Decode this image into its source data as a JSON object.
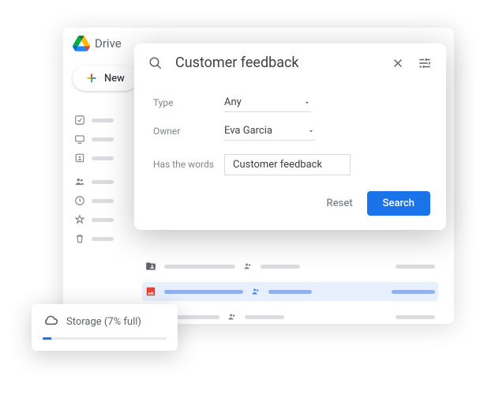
{
  "app": {
    "name": "Drive"
  },
  "new_button": {
    "label": "New"
  },
  "search": {
    "query": "Customer feedback",
    "filters": {
      "type": {
        "label": "Type",
        "value": "Any"
      },
      "owner": {
        "label": "Owner",
        "value": "Eva Garcia"
      },
      "words": {
        "label": "Has the words",
        "value": "Customer feedback"
      }
    },
    "actions": {
      "reset": "Reset",
      "search": "Search"
    }
  },
  "storage": {
    "label": "Storage (7% full)",
    "percent": 7
  }
}
